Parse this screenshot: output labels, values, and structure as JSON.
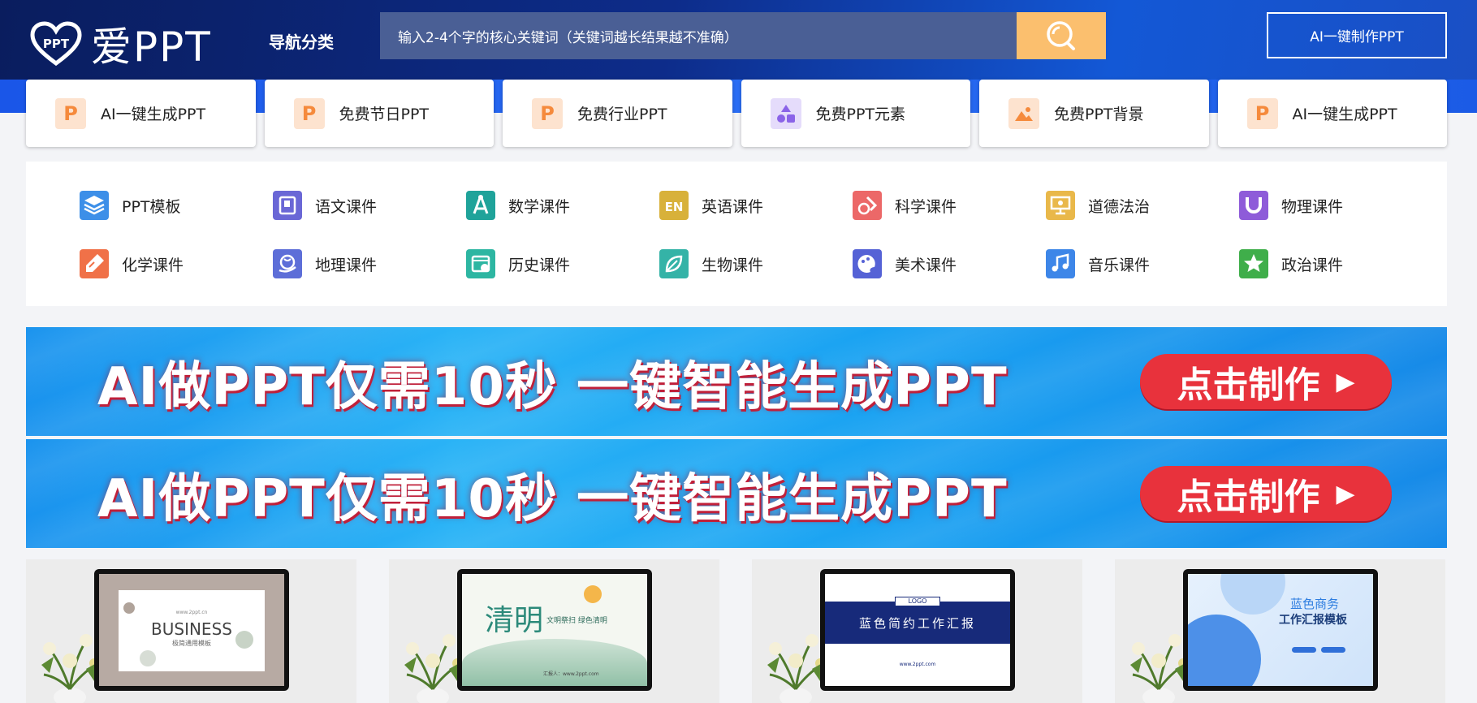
{
  "header": {
    "logo_text": "爱PPT",
    "logo_badge": "PPT",
    "nav_category": "导航分类",
    "search_placeholder": "输入2-4个字的核心关键词（关键词越长结果越不准确）",
    "ai_button": "AI一键制作PPT"
  },
  "cards": [
    {
      "label": "AI一键生成PPT",
      "icon": "p-icon",
      "glyph": "P",
      "bg": "#fde3cf",
      "fg": "#f58a3c"
    },
    {
      "label": "免费节日PPT",
      "icon": "p-icon",
      "glyph": "P",
      "bg": "#fde3cf",
      "fg": "#f58a3c"
    },
    {
      "label": "免费行业PPT",
      "icon": "p-icon",
      "glyph": "P",
      "bg": "#fde3cf",
      "fg": "#f58a3c"
    },
    {
      "label": "免费PPT元素",
      "icon": "shapes-icon",
      "glyph": "",
      "bg": "#e5dcfb",
      "fg": "#8a63e8"
    },
    {
      "label": "免费PPT背景",
      "icon": "image-icon",
      "glyph": "",
      "bg": "#fde3cf",
      "fg": "#f58a3c"
    },
    {
      "label": "AI一键生成PPT",
      "icon": "p-icon",
      "glyph": "P",
      "bg": "#fde3cf",
      "fg": "#f58a3c"
    }
  ],
  "subjects": {
    "row1": [
      {
        "label": "PPT模板",
        "icon": "layers-icon",
        "color": "#3d8fe8"
      },
      {
        "label": "语文课件",
        "icon": "book-icon",
        "color": "#6a67d6"
      },
      {
        "label": "数学课件",
        "icon": "compass-icon",
        "color": "#1fa39a"
      },
      {
        "label": "英语课件",
        "icon": "en-icon",
        "color": "#d8b13a"
      },
      {
        "label": "科学课件",
        "icon": "flask-icon",
        "color": "#ec6868"
      },
      {
        "label": "道德法治",
        "icon": "board-icon",
        "color": "#e9b84a"
      },
      {
        "label": "物理课件",
        "icon": "magnet-icon",
        "color": "#8e5bd9"
      }
    ],
    "row2": [
      {
        "label": "化学课件",
        "icon": "tube-icon",
        "color": "#f07148"
      },
      {
        "label": "地理课件",
        "icon": "globe-icon",
        "color": "#5d6ed8"
      },
      {
        "label": "历史课件",
        "icon": "calendar-icon",
        "color": "#2db6a2"
      },
      {
        "label": "生物课件",
        "icon": "leaf-icon",
        "color": "#34b3a7"
      },
      {
        "label": "美术课件",
        "icon": "palette-icon",
        "color": "#5562d6"
      },
      {
        "label": "音乐课件",
        "icon": "music-icon",
        "color": "#3d86e8"
      },
      {
        "label": "政治课件",
        "icon": "star-icon",
        "color": "#3fae4a"
      }
    ]
  },
  "banners": [
    {
      "text": "AI做PPT仅需10秒    一键智能生成PPT",
      "cta": "点击制作"
    },
    {
      "text": "AI做PPT仅需10秒    一键智能生成PPT",
      "cta": "点击制作"
    }
  ],
  "thumbs": [
    {
      "title": "BUSINESS",
      "subtitle": "极简通用模板",
      "caption": "www.2ppt.cn"
    },
    {
      "title": "清明",
      "subtitle": "文明祭扫 绿色清明",
      "caption": "汇报人：www.2ppt.com"
    },
    {
      "title": "蓝色简约工作汇报",
      "subtitle": "LOGO",
      "caption": "www.2ppt.com"
    },
    {
      "title": "蓝色商务",
      "subtitle": "工作汇报模板",
      "caption": ""
    }
  ]
}
